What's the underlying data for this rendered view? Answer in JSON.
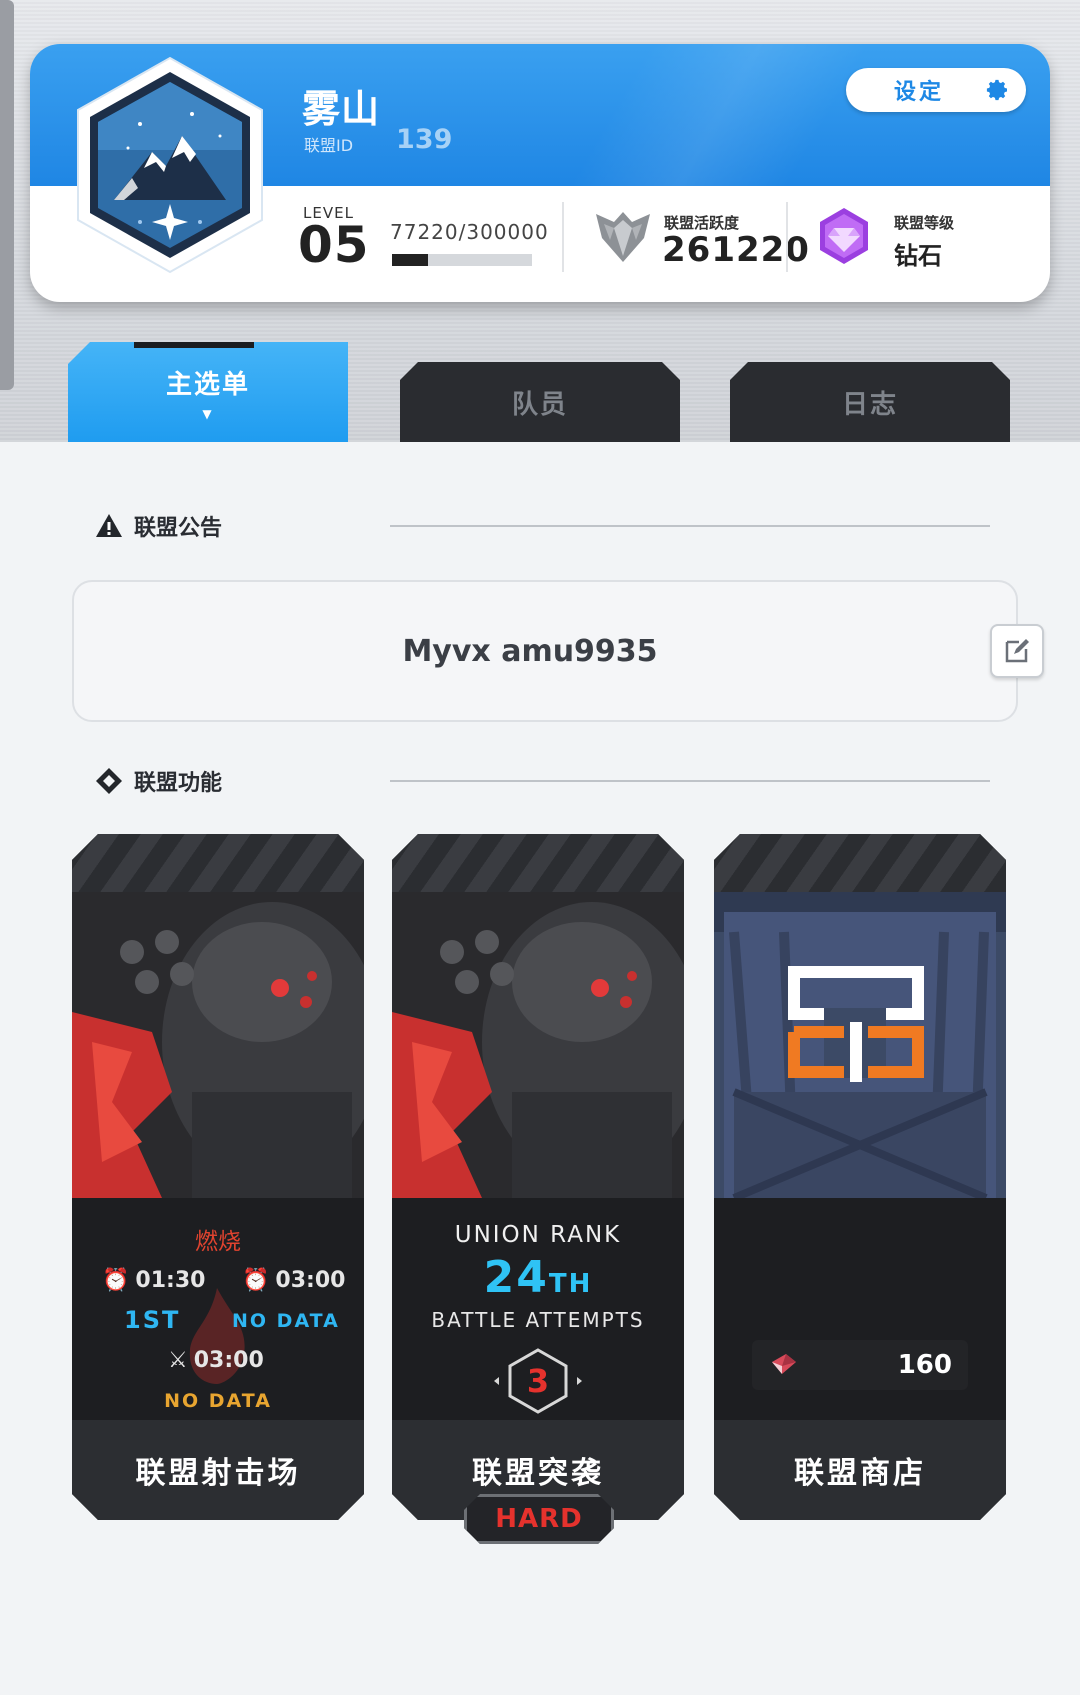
{
  "union": {
    "name": "雾山",
    "id_label": "联盟ID",
    "id_value": "139",
    "settings_label": "设定",
    "level_label": "LEVEL",
    "level_value": "05",
    "exp_text": "77220/300000",
    "exp_progress": 0.2574,
    "activity_label": "联盟活跃度",
    "activity_value": "261220",
    "rank_label": "联盟等级",
    "rank_value": "钻石"
  },
  "tabs": [
    {
      "label": "主选单",
      "active": true
    },
    {
      "label": "队员",
      "active": false
    },
    {
      "label": "日志",
      "active": false
    }
  ],
  "notice": {
    "title": "联盟公告",
    "text": "Myvx amu9935"
  },
  "features": {
    "title": "联盟功能",
    "range": {
      "title": "联盟射击场",
      "burn_label": "燃烧",
      "timer_1": "01:30",
      "timer_2": "03:00",
      "rank_1": "1ST",
      "rank_2": "NO DATA",
      "timer_3": "03:00",
      "rank_3": "NO DATA"
    },
    "raid": {
      "title": "联盟突袭",
      "union_rank_label": "UNION RANK",
      "union_rank_value": "24",
      "union_rank_suffix": "TH",
      "battle_attempts_label": "BATTLE ATTEMPTS",
      "attempts": "3",
      "difficulty": "HARD"
    },
    "shop": {
      "title": "联盟商店",
      "currency_amount": "160"
    }
  },
  "colors": {
    "accent_blue": "#1f86e4",
    "tab_active": "#2aa6f3",
    "alert_red": "#e5322d",
    "rank_cyan": "#2fc3f5",
    "warning_orange": "#e8a530"
  }
}
